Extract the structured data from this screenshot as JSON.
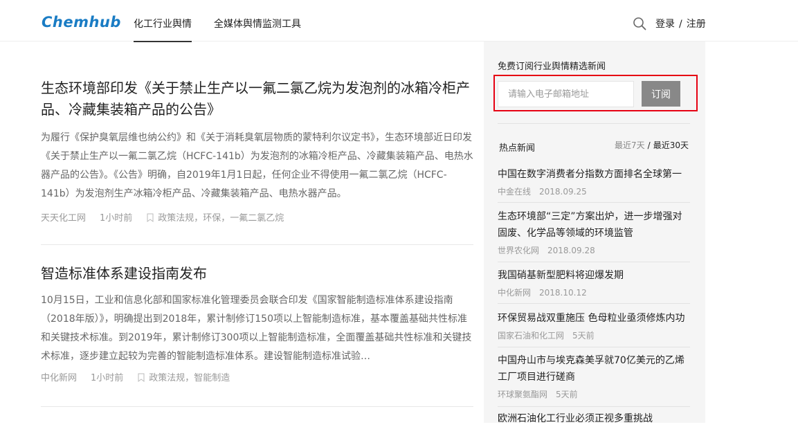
{
  "header": {
    "logo": "Chemhub",
    "nav": [
      "化工行业舆情",
      "全媒体舆情监测工具"
    ],
    "login": "登录",
    "register": "注册",
    "login_sep": "/"
  },
  "articles": [
    {
      "title": "生态环境部印发《关于禁止生产以一氟二氯乙烷为发泡剂的冰箱冷柜产品、冷藏集装箱产品的公告》",
      "summary": "为履行《保护臭氧层维也纳公约》和《关于消耗臭氧层物质的蒙特利尔议定书》，生态环境部近日印发《关于禁止生产以一氟二氯乙烷（HCFC-141b）为发泡剂的冰箱冷柜产品、冷藏集装箱产品、电热水器产品的公告》。《公告》明确，自2019年1月1日起，任何企业不得使用一氟二氯乙烷（HCFC-141b）为发泡剂生产冰箱冷柜产品、冷藏集装箱产品、电热水器产品。",
      "source": "天天化工网",
      "time": "1小时前",
      "tags": "政策法规，环保，一氟二氯乙烷"
    },
    {
      "title": "智造标准体系建设指南发布",
      "summary": "10月15日，工业和信息化部和国家标准化管理委员会联合印发《国家智能制造标准体系建设指南（2018年版）》，明确提出到2018年，累计制修订150项以上智能制造标准，基本覆盖基础共性标准和关键技术标准。到2019年，累计制修订300项以上智能制造标准，全面覆盖基础共性标准和关键技术标准，逐步建立起较为完善的智能制造标准体系。建设智能制造标准试验…",
      "source": "中化新网",
      "time": "1小时前",
      "tags": "政策法规，智能制造"
    }
  ],
  "sidebar": {
    "subscribe_title": "免费订阅行业舆情精选新闻",
    "email_placeholder": "请输入电子邮箱地址",
    "subscribe_button": "订阅",
    "hot_title": "热点新闻",
    "filter_7": "最近7天",
    "filter_sep": "/",
    "filter_30": "最近30天",
    "news": [
      {
        "title": "中国在数字消费者分指数方面排名全球第一",
        "source": "中金在线",
        "date": "2018.09.25"
      },
      {
        "title": "生态环境部“三定”方案出炉，进一步增强对固废、化学品等领域的环境监管",
        "source": "世界农化网",
        "date": "2018.09.28"
      },
      {
        "title": "我国硝基新型肥料将迎爆发期",
        "source": "中化新网",
        "date": "2018.10.12"
      },
      {
        "title": "环保贸易战双重施压 色母粒业亟须修炼内功",
        "source": "国家石油和化工网",
        "date": "5天前"
      },
      {
        "title": "中国舟山市与埃克森美孚就70亿美元的乙烯工厂项目进行磋商",
        "source": "环球聚氨酯网",
        "date": "5天前"
      },
      {
        "title": "欧洲石油化工行业必须正视多重挑战",
        "source": "",
        "date": ""
      }
    ]
  },
  "colors": {
    "brand": "#1a7cc4",
    "highlight_border": "#e60012",
    "button_bg": "#888888"
  }
}
